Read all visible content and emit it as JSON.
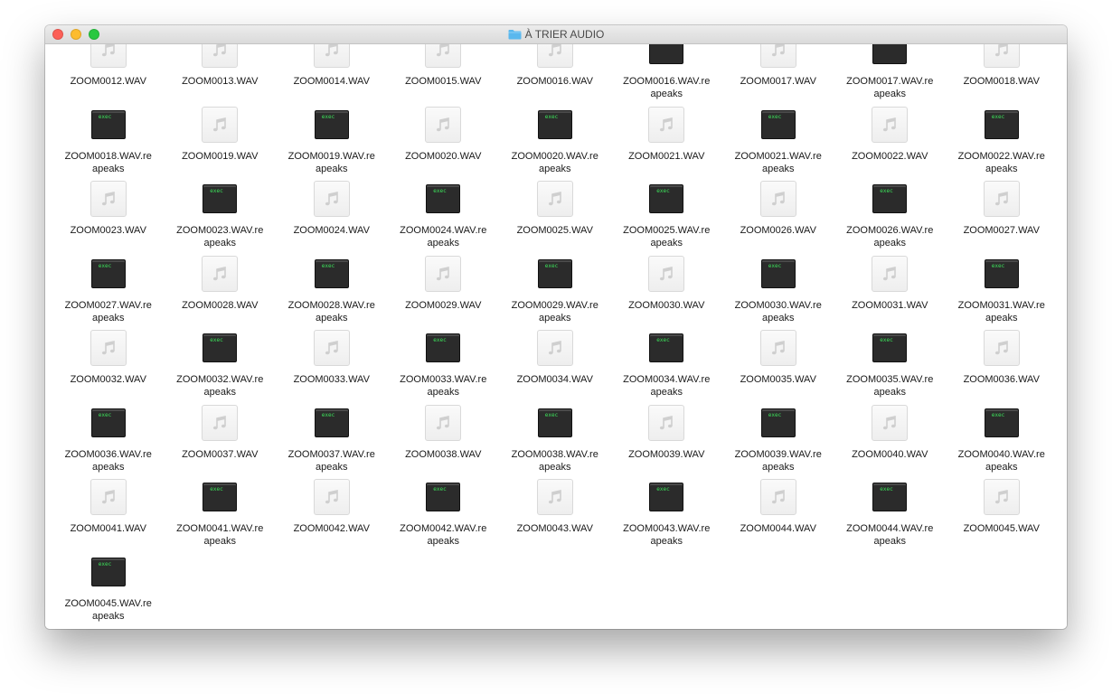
{
  "window": {
    "title": "À TRIER AUDIO",
    "title_icon": "folder-icon"
  },
  "colors": {
    "close": "#fc5f57",
    "minimize": "#fdbc2e",
    "zoom": "#28c840",
    "exec_text": "#3ce05a",
    "folder": "#5ab8ee"
  },
  "files": [
    {
      "name": "ZOOM0012.WAV",
      "icon": "audio-file-icon"
    },
    {
      "name": "ZOOM0013.WAV",
      "icon": "audio-file-icon"
    },
    {
      "name": "ZOOM0014.WAV",
      "icon": "audio-file-icon"
    },
    {
      "name": "ZOOM0015.WAV",
      "icon": "audio-file-icon"
    },
    {
      "name": "ZOOM0016.WAV",
      "icon": "audio-file-icon"
    },
    {
      "name": "ZOOM0016.WAV.reapeaks",
      "icon": "exec-file-icon"
    },
    {
      "name": "ZOOM0017.WAV",
      "icon": "audio-file-icon"
    },
    {
      "name": "ZOOM0017.WAV.reapeaks",
      "icon": "exec-file-icon"
    },
    {
      "name": "ZOOM0018.WAV",
      "icon": "audio-file-icon"
    },
    {
      "name": "ZOOM0018.WAV.reapeaks",
      "icon": "exec-file-icon"
    },
    {
      "name": "ZOOM0019.WAV",
      "icon": "audio-file-icon"
    },
    {
      "name": "ZOOM0019.WAV.reapeaks",
      "icon": "exec-file-icon"
    },
    {
      "name": "ZOOM0020.WAV",
      "icon": "audio-file-icon"
    },
    {
      "name": "ZOOM0020.WAV.reapeaks",
      "icon": "exec-file-icon"
    },
    {
      "name": "ZOOM0021.WAV",
      "icon": "audio-file-icon"
    },
    {
      "name": "ZOOM0021.WAV.reapeaks",
      "icon": "exec-file-icon"
    },
    {
      "name": "ZOOM0022.WAV",
      "icon": "audio-file-icon"
    },
    {
      "name": "ZOOM0022.WAV.reapeaks",
      "icon": "exec-file-icon"
    },
    {
      "name": "ZOOM0023.WAV",
      "icon": "audio-file-icon"
    },
    {
      "name": "ZOOM0023.WAV.reapeaks",
      "icon": "exec-file-icon"
    },
    {
      "name": "ZOOM0024.WAV",
      "icon": "audio-file-icon"
    },
    {
      "name": "ZOOM0024.WAV.reapeaks",
      "icon": "exec-file-icon"
    },
    {
      "name": "ZOOM0025.WAV",
      "icon": "audio-file-icon"
    },
    {
      "name": "ZOOM0025.WAV.reapeaks",
      "icon": "exec-file-icon"
    },
    {
      "name": "ZOOM0026.WAV",
      "icon": "audio-file-icon"
    },
    {
      "name": "ZOOM0026.WAV.reapeaks",
      "icon": "exec-file-icon"
    },
    {
      "name": "ZOOM0027.WAV",
      "icon": "audio-file-icon"
    },
    {
      "name": "ZOOM0027.WAV.reapeaks",
      "icon": "exec-file-icon"
    },
    {
      "name": "ZOOM0028.WAV",
      "icon": "audio-file-icon"
    },
    {
      "name": "ZOOM0028.WAV.reapeaks",
      "icon": "exec-file-icon"
    },
    {
      "name": "ZOOM0029.WAV",
      "icon": "audio-file-icon"
    },
    {
      "name": "ZOOM0029.WAV.reapeaks",
      "icon": "exec-file-icon"
    },
    {
      "name": "ZOOM0030.WAV",
      "icon": "audio-file-icon"
    },
    {
      "name": "ZOOM0030.WAV.reapeaks",
      "icon": "exec-file-icon"
    },
    {
      "name": "ZOOM0031.WAV",
      "icon": "audio-file-icon"
    },
    {
      "name": "ZOOM0031.WAV.reapeaks",
      "icon": "exec-file-icon"
    },
    {
      "name": "ZOOM0032.WAV",
      "icon": "audio-file-icon"
    },
    {
      "name": "ZOOM0032.WAV.reapeaks",
      "icon": "exec-file-icon"
    },
    {
      "name": "ZOOM0033.WAV",
      "icon": "audio-file-icon"
    },
    {
      "name": "ZOOM0033.WAV.reapeaks",
      "icon": "exec-file-icon"
    },
    {
      "name": "ZOOM0034.WAV",
      "icon": "audio-file-icon"
    },
    {
      "name": "ZOOM0034.WAV.reapeaks",
      "icon": "exec-file-icon"
    },
    {
      "name": "ZOOM0035.WAV",
      "icon": "audio-file-icon"
    },
    {
      "name": "ZOOM0035.WAV.reapeaks",
      "icon": "exec-file-icon"
    },
    {
      "name": "ZOOM0036.WAV",
      "icon": "audio-file-icon"
    },
    {
      "name": "ZOOM0036.WAV.reapeaks",
      "icon": "exec-file-icon"
    },
    {
      "name": "ZOOM0037.WAV",
      "icon": "audio-file-icon"
    },
    {
      "name": "ZOOM0037.WAV.reapeaks",
      "icon": "exec-file-icon"
    },
    {
      "name": "ZOOM0038.WAV",
      "icon": "audio-file-icon"
    },
    {
      "name": "ZOOM0038.WAV.reapeaks",
      "icon": "exec-file-icon"
    },
    {
      "name": "ZOOM0039.WAV",
      "icon": "audio-file-icon"
    },
    {
      "name": "ZOOM0039.WAV.reapeaks",
      "icon": "exec-file-icon"
    },
    {
      "name": "ZOOM0040.WAV",
      "icon": "audio-file-icon"
    },
    {
      "name": "ZOOM0040.WAV.reapeaks",
      "icon": "exec-file-icon"
    },
    {
      "name": "ZOOM0041.WAV",
      "icon": "audio-file-icon"
    },
    {
      "name": "ZOOM0041.WAV.reapeaks",
      "icon": "exec-file-icon"
    },
    {
      "name": "ZOOM0042.WAV",
      "icon": "audio-file-icon"
    },
    {
      "name": "ZOOM0042.WAV.reapeaks",
      "icon": "exec-file-icon"
    },
    {
      "name": "ZOOM0043.WAV",
      "icon": "audio-file-icon"
    },
    {
      "name": "ZOOM0043.WAV.reapeaks",
      "icon": "exec-file-icon"
    },
    {
      "name": "ZOOM0044.WAV",
      "icon": "audio-file-icon"
    },
    {
      "name": "ZOOM0044.WAV.reapeaks",
      "icon": "exec-file-icon"
    },
    {
      "name": "ZOOM0045.WAV",
      "icon": "audio-file-icon"
    },
    {
      "name": "ZOOM0045.WAV.reapeaks",
      "icon": "exec-file-icon"
    }
  ],
  "exec_badge": "exec"
}
